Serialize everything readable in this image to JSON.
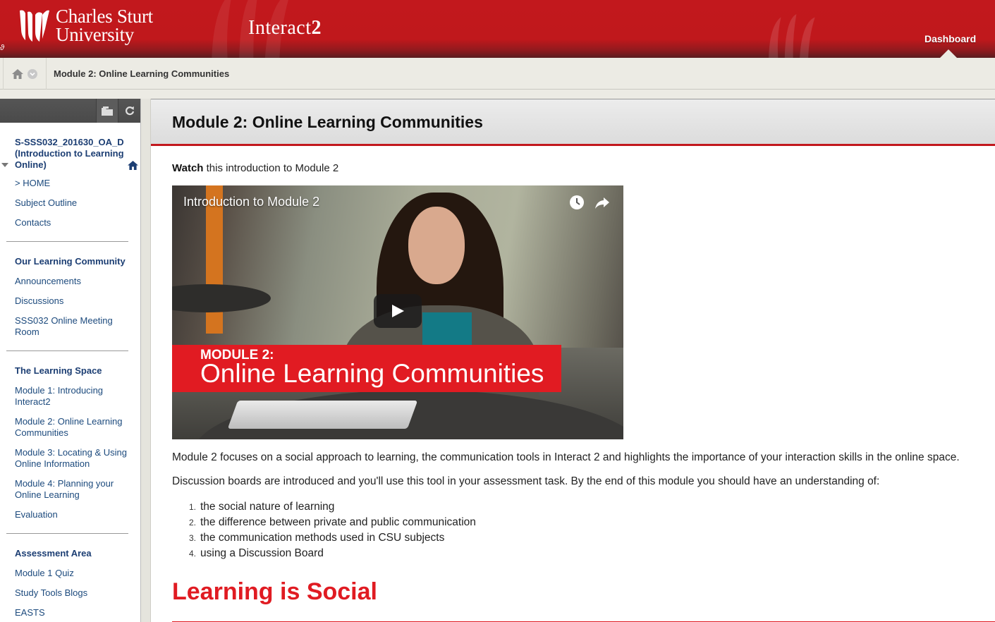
{
  "header": {
    "institution_line1": "Charles Sturt",
    "institution_line2": "University",
    "app_name_prefix": "Interact",
    "app_name_suffix": "2",
    "nav_link": "Dashboard"
  },
  "breadcrumb": {
    "current": "Module 2: Online Learning Communities"
  },
  "sidebar": {
    "course_title": "S-SSS032_201630_OA_D (Introduction to Learning Online)",
    "groups": [
      {
        "heading": null,
        "items": [
          "> HOME",
          "Subject Outline",
          "Contacts"
        ]
      },
      {
        "heading": "Our Learning Community",
        "items": [
          "Announcements",
          "Discussions",
          "SSS032 Online Meeting Room"
        ]
      },
      {
        "heading": "The Learning Space",
        "items": [
          "Module 1: Introducing Interact2",
          "Module 2: Online Learning Communities",
          "Module 3: Locating & Using Online Information",
          "Module 4: Planning your Online Learning",
          "Evaluation"
        ]
      },
      {
        "heading": "Assessment Area",
        "items": [
          "Module 1 Quiz",
          "Study Tools Blogs",
          "EASTS"
        ]
      }
    ]
  },
  "main": {
    "page_title": "Module 2: Online Learning Communities",
    "intro_bold": "Watch",
    "intro_rest": " this introduction to Module 2",
    "video": {
      "title": "Introduction to Module 2",
      "banner_kicker": "MODULE 2:",
      "banner_title": "Online Learning Communities",
      "icons": [
        "watch-later-icon",
        "share-icon",
        "play-icon"
      ]
    },
    "paragraph1": "Module 2 focuses on a social approach to learning, the communication tools in Interact 2 and highlights the importance of your interaction skills in the online space.",
    "paragraph2": "Discussion boards are introduced and you'll use this tool in your assessment task. By the end of this module you should have an understanding of:",
    "objectives": [
      {
        "num": "1.",
        "text": "the social nature of learning"
      },
      {
        "num": "2.",
        "text": "the difference between private and public communication"
      },
      {
        "num": "3.",
        "text": "the communication methods used in CSU subjects"
      },
      {
        "num": "4.",
        "text": "using a Discussion Board"
      }
    ],
    "section_heading": "Learning is Social"
  },
  "colors": {
    "brand_red": "#c2181d",
    "accent_red": "#e01b22",
    "link_blue": "#1c4a7d"
  }
}
